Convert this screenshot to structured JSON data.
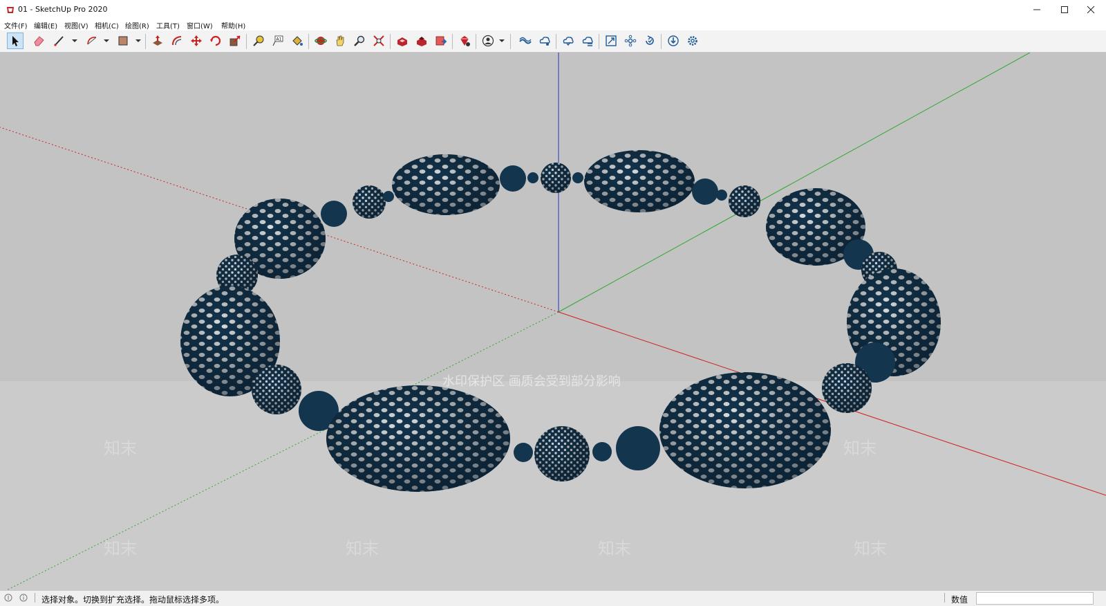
{
  "window": {
    "title": "01 - SketchUp Pro 2020",
    "icon": "sketchup-app-icon",
    "controls": [
      "minimize-icon",
      "maximize-icon",
      "close-icon"
    ]
  },
  "menu": [
    "文件(F)",
    "编辑(E)",
    "视图(V)",
    "相机(C)",
    "绘图(R)",
    "工具(T)",
    "窗口(W)",
    "帮助(H)"
  ],
  "toolbar": {
    "tools": [
      "select-icon",
      "eraser-icon",
      "line-icon",
      "arc-icon",
      "rectangle-icon",
      "push-pull-icon",
      "offset-icon",
      "move-icon",
      "rotate-icon",
      "scale-icon",
      "tape-measure-icon",
      "text-icon",
      "paint-bucket-icon",
      "orbit-icon",
      "pan-icon",
      "zoom-icon",
      "zoom-extents-icon",
      "warehouse-icon",
      "extension-warehouse-icon",
      "send-to-layout-icon",
      "extension-manager-icon",
      "account-icon",
      "trimble-connect-icon",
      "connect-share-icon",
      "cloud-sync-icon",
      "cloud-list-icon",
      "section-icon",
      "components-icon",
      "refresh-icon",
      "download-icon",
      "settings-icon"
    ]
  },
  "viewport": {
    "background": "#c3c3c3",
    "model_color": "#14354e",
    "axis_colors": {
      "x": "#d11f1f",
      "y": "#2fa82f",
      "z": "#1f2fd1"
    },
    "watermark": "水印保护区   画质会受到部分影响",
    "watermark_brand": "知末"
  },
  "statusbar": {
    "hint": "选择对象。切换到扩充选择。拖动鼠标选择多项。",
    "measure_label": "数值",
    "measure_value": ""
  }
}
